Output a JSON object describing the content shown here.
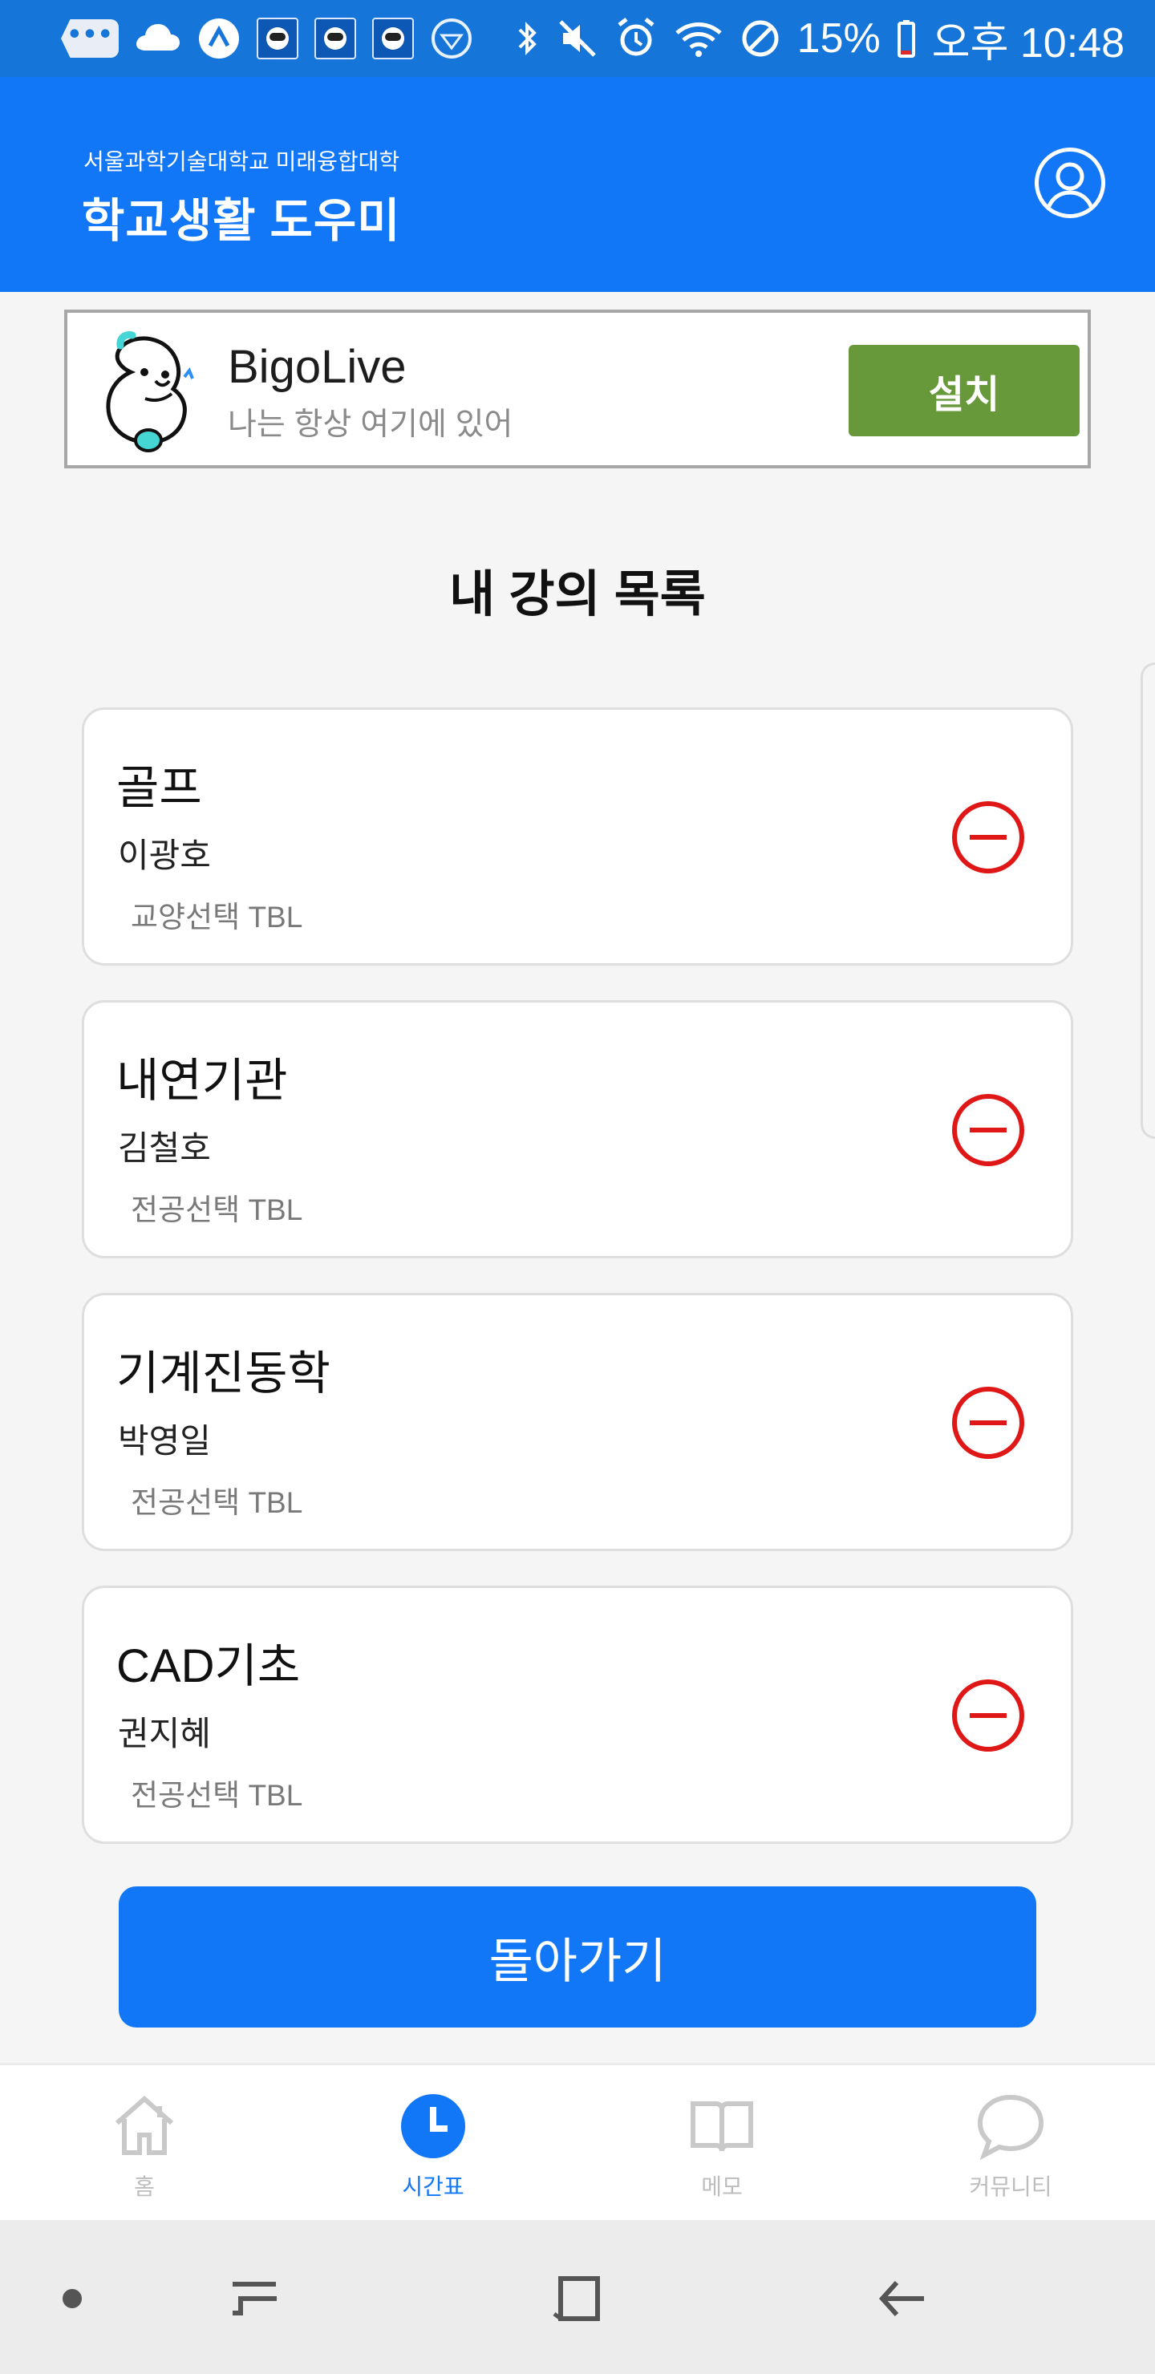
{
  "status_bar": {
    "battery": "15%",
    "time": "오후 10:48",
    "icons": [
      "more-icon",
      "cloud-icon",
      "app-a-icon",
      "school-app-icon",
      "school-app-icon",
      "school-app-icon",
      "diamond-icon",
      "bluetooth-icon",
      "mute-icon",
      "alarm-icon",
      "wifi-icon",
      "no-disturb-icon",
      "battery-icon"
    ]
  },
  "header": {
    "school_name": "서울과학기술대학교 미래융합대학",
    "title": "학교생활 도우미",
    "profile_icon": "user-icon",
    "background_color": "#1177f6"
  },
  "ad": {
    "title": "BigoLive",
    "subtitle": "나는 항상 여기에 있어",
    "install_label": "설치",
    "install_color": "#67993b",
    "mascot_icon": "mascot-icon"
  },
  "main": {
    "section_title": "내 강의 목록",
    "courses": [
      {
        "name": "골프",
        "professor": "이광호",
        "meta": "교양선택 TBL"
      },
      {
        "name": "내연기관",
        "professor": "김철호",
        "meta": "전공선택 TBL"
      },
      {
        "name": "기계진동학",
        "professor": "박영일",
        "meta": "전공선택 TBL"
      },
      {
        "name": "CAD기초",
        "professor": "권지혜",
        "meta": "전공선택 TBL"
      }
    ],
    "back_label": "돌아가기"
  },
  "bottom_nav": {
    "items": [
      {
        "label": "홈",
        "icon": "home-icon",
        "active": false
      },
      {
        "label": "시간표",
        "icon": "clock-icon",
        "active": true
      },
      {
        "label": "메모",
        "icon": "book-icon",
        "active": false
      },
      {
        "label": "커뮤니티",
        "icon": "chat-icon",
        "active": false
      }
    ],
    "active_color": "#1177f6",
    "inactive_color": "#bdbdbd"
  },
  "android_nav": {
    "icons": [
      "dot-icon",
      "recent-apps-icon",
      "home-square-icon",
      "back-arrow-icon"
    ]
  }
}
